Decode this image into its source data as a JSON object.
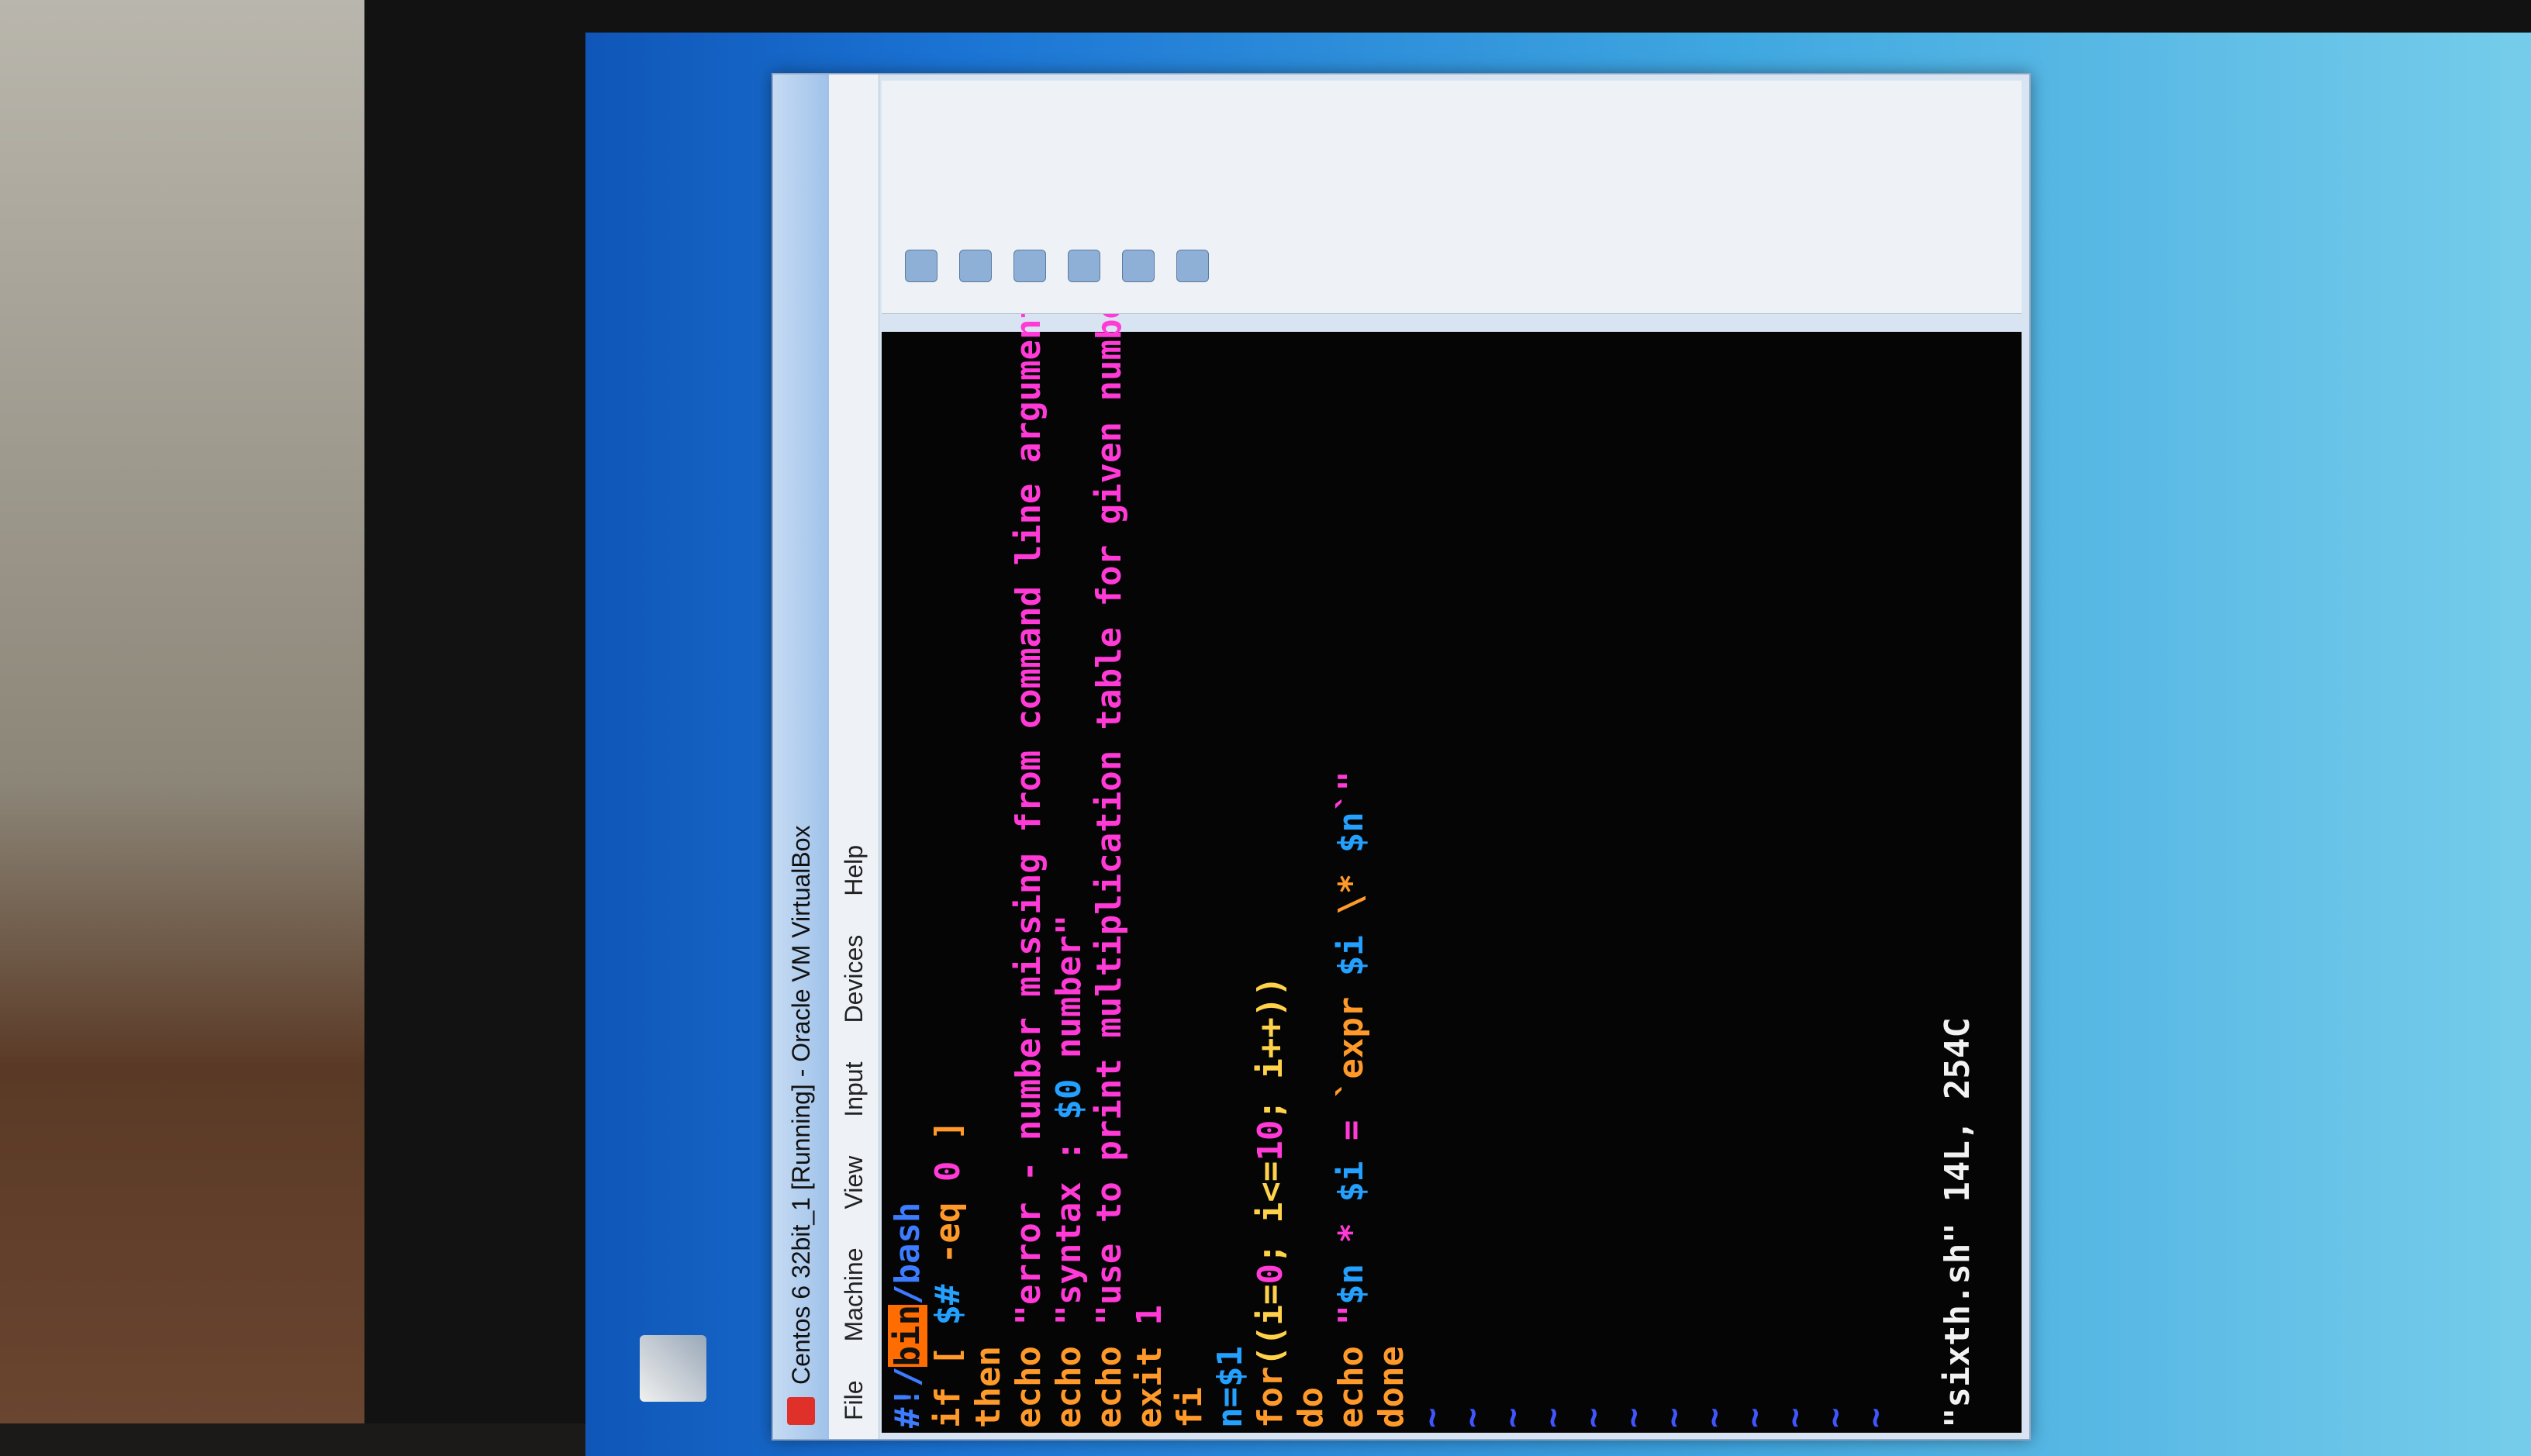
{
  "window": {
    "title": "Centos 6 32bit_1 [Running] - Oracle VM VirtualBox"
  },
  "menubar": {
    "file": "File",
    "machine": "Machine",
    "view": "View",
    "input": "Input",
    "devices": "Devices",
    "help": "Help"
  },
  "terminal": {
    "line1_hash": "#!/",
    "line1_bin": "bin",
    "line1_rest": "/bash",
    "line2_if": "if [ ",
    "line2_var": "$#",
    "line2_op": " -eq ",
    "line2_num": "0",
    "line2_end": " ]",
    "line3": "then",
    "line4_cmd": "echo ",
    "line4_str": "\"error - number missing from command line argument\"",
    "line5_cmd": "echo ",
    "line5_str1": "\"syntax : ",
    "line5_var": "$0",
    "line5_str2": " number\"",
    "line6_cmd": "echo ",
    "line6_str": "\"use to print multiplication table for given number\"",
    "line7_cmd": "exit ",
    "line7_num": "1",
    "line8": "fi",
    "line9_var": "n=",
    "line9_val": "$1",
    "line10_kw": "for",
    "line10_a": "((i=",
    "line10_n0": "0",
    "line10_b": "; i<=",
    "line10_n10": "10",
    "line10_c": "; i++))",
    "line11": "do",
    "line12_cmd": "echo ",
    "line12_q": "\"",
    "line12_vn": "$n",
    "line12_star": " * ",
    "line12_vi": "$i",
    "line12_eq": " = ",
    "line12_expr": "`expr ",
    "line12_vi2": "$i",
    "line12_mul": " \\* ",
    "line12_vn2": "$n",
    "line12_tail": "`\"",
    "line13": "done",
    "tilde": "~",
    "status": "\"sixth.sh\" 14L, 254C"
  },
  "colors": {
    "terminal_bg": "#050505",
    "string": "#ff3ad6",
    "keyword": "#ff9a2a",
    "variable": "#24a0ff",
    "tilde": "#3f56ff"
  },
  "icons": {
    "app": "virtualbox-icon",
    "start": "windows-start-icon",
    "ie": "internet-explorer-icon",
    "explorer": "folder-icon",
    "maps": "maps-icon",
    "chrome": "chrome-icon",
    "vbox_taskbar": "virtualbox-taskbar-icon"
  }
}
